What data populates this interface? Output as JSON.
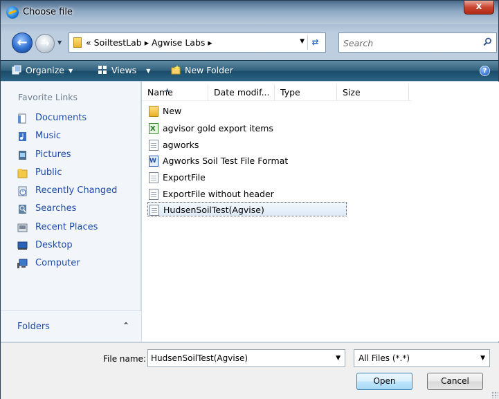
{
  "window": {
    "title": "Choose file"
  },
  "navigation": {
    "path_prefix": "«",
    "path": [
      "SoiltestLab",
      "Agwise Labs"
    ],
    "path_separator": "▸",
    "search_placeholder": "Search"
  },
  "toolbar": {
    "organize": "Organize",
    "views": "Views",
    "new_folder": "New Folder",
    "help": "?"
  },
  "sidebar": {
    "title": "Favorite Links",
    "items": [
      {
        "label": "Documents",
        "icon": "documents-icon"
      },
      {
        "label": "Music",
        "icon": "music-icon"
      },
      {
        "label": "Pictures",
        "icon": "pictures-icon"
      },
      {
        "label": "Public",
        "icon": "public-folder-icon"
      },
      {
        "label": "Recently Changed",
        "icon": "recently-changed-icon"
      },
      {
        "label": "Searches",
        "icon": "searches-icon"
      },
      {
        "label": "Recent Places",
        "icon": "recent-places-icon"
      },
      {
        "label": "Desktop",
        "icon": "desktop-icon"
      },
      {
        "label": "Computer",
        "icon": "computer-icon"
      }
    ],
    "folders_label": "Folders",
    "folders_chevron": "⌃"
  },
  "filelist": {
    "columns": [
      "Name",
      "Date modif...",
      "Type",
      "Size"
    ],
    "files": [
      {
        "name": "New",
        "icon": "folder-icon"
      },
      {
        "name": "agvisor gold export items",
        "icon": "excel-file-icon"
      },
      {
        "name": "agworks",
        "icon": "text-file-icon"
      },
      {
        "name": "Agworks Soil Test File Format",
        "icon": "word-file-icon"
      },
      {
        "name": "ExportFile",
        "icon": "text-file-icon"
      },
      {
        "name": "ExportFile without header",
        "icon": "text-file-icon"
      },
      {
        "name": "HudsenSoilTest(Agvise)",
        "icon": "text-file-icon",
        "selected": true
      }
    ]
  },
  "footer": {
    "filename_label": "File name:",
    "filename_value": "HudsenSoilTest(Agvise)",
    "filetype_value": "All Files (*.*)",
    "open_label": "Open",
    "cancel_label": "Cancel"
  },
  "colors": {
    "link_blue": "#1e4aa8",
    "toolbar_teal": "#2a6486",
    "close_red": "#c8452e"
  }
}
